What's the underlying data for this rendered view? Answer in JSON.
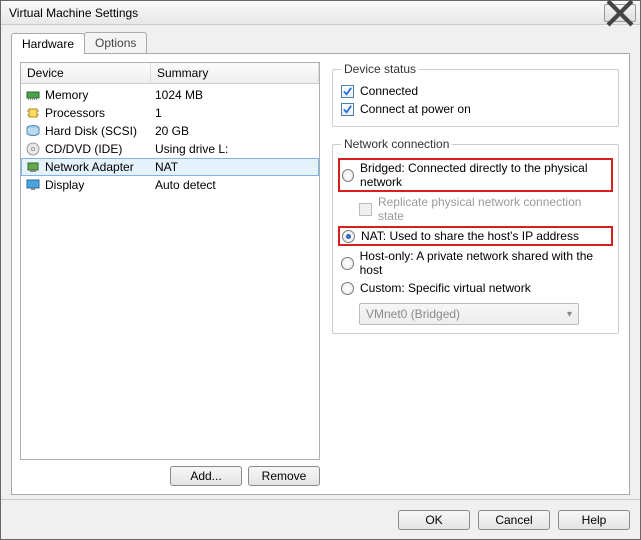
{
  "window": {
    "title": "Virtual Machine Settings"
  },
  "tabs": {
    "hardware": "Hardware",
    "options": "Options"
  },
  "device_table": {
    "col_device": "Device",
    "col_summary": "Summary",
    "rows": [
      {
        "icon": "memory-icon",
        "name": "Memory",
        "summary": "1024 MB"
      },
      {
        "icon": "cpu-icon",
        "name": "Processors",
        "summary": "1"
      },
      {
        "icon": "disk-icon",
        "name": "Hard Disk (SCSI)",
        "summary": "20 GB"
      },
      {
        "icon": "cd-icon",
        "name": "CD/DVD (IDE)",
        "summary": "Using drive L:"
      },
      {
        "icon": "network-icon",
        "name": "Network Adapter",
        "summary": "NAT"
      },
      {
        "icon": "display-icon",
        "name": "Display",
        "summary": "Auto detect"
      }
    ],
    "selected_index": 4,
    "buttons": {
      "add": "Add...",
      "remove": "Remove"
    }
  },
  "device_status": {
    "legend": "Device status",
    "connected": "Connected",
    "connect_power_on": "Connect at power on"
  },
  "network_connection": {
    "legend": "Network connection",
    "bridged": "Bridged: Connected directly to the physical network",
    "replicate": "Replicate physical network connection state",
    "nat": "NAT: Used to share the host's IP address",
    "hostonly": "Host-only: A private network shared with the host",
    "custom": "Custom: Specific virtual network",
    "custom_value": "VMnet0 (Bridged)"
  },
  "footer": {
    "ok": "OK",
    "cancel": "Cancel",
    "help": "Help"
  }
}
